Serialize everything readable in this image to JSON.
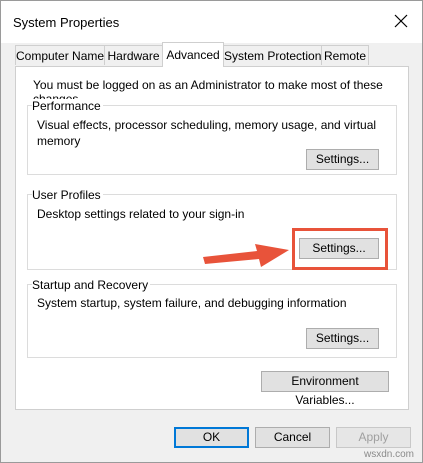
{
  "window": {
    "title": "System Properties"
  },
  "tabs": [
    {
      "label": "Computer Name"
    },
    {
      "label": "Hardware"
    },
    {
      "label": "Advanced"
    },
    {
      "label": "System Protection"
    },
    {
      "label": "Remote"
    }
  ],
  "active_tab": "Advanced",
  "notice": "You must be logged on as an Administrator to make most of these changes.",
  "performance": {
    "title": "Performance",
    "description_line1": "Visual effects, processor scheduling, memory usage, and virtual",
    "description_line2": "memory",
    "button": "Settings..."
  },
  "user_profiles": {
    "title": "User Profiles",
    "description": "Desktop settings related to your sign-in",
    "button": "Settings..."
  },
  "startup_recovery": {
    "title": "Startup and Recovery",
    "description": "System startup, system failure, and debugging information",
    "button": "Settings..."
  },
  "environment_button": "Environment Variables...",
  "footer": {
    "ok": "OK",
    "cancel": "Cancel",
    "apply": "Apply"
  },
  "annotation": {
    "highlight_color": "#e8533a",
    "arrow_color": "#e8533a"
  },
  "watermark": "wsxdn.com",
  "colors": {
    "window_bg": "#f0f0f0",
    "panel_bg": "#ffffff",
    "default_button_border": "#0078d7"
  }
}
